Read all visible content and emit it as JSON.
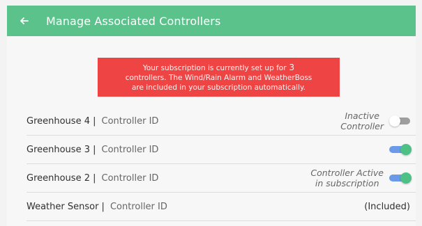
{
  "header": {
    "title": "Manage Associated Controllers",
    "back_icon": "arrow-left-icon"
  },
  "notice": {
    "line1": "Your subscription is currently set up for",
    "count": "3",
    "line2": "controllers. The Wind/Rain Alarm and WeatherBoss",
    "line3": "are included in your subscription automatically."
  },
  "controllers": [
    {
      "name": "Greenhouse 4 |",
      "id_label": "Controller ID",
      "status_line1": "Inactive",
      "status_line2": "Controller",
      "toggle": "off"
    },
    {
      "name": "Greenhouse 3 |",
      "id_label": "Controller ID",
      "toggle": "on"
    },
    {
      "name": "Greenhouse 2 |",
      "id_label": "Controller ID",
      "status_line1": "Controller Active",
      "status_line2": "in subscription",
      "toggle": "on"
    },
    {
      "name": "Weather Sensor |",
      "id_label": "Controller ID",
      "included": "(Included)"
    }
  ],
  "colors": {
    "header": "#5bc28b",
    "notice": "#ef4444",
    "toggle_on_track": "#6b9be8",
    "toggle_on_thumb": "#4cc085",
    "toggle_off_track": "#9e9e9e"
  }
}
